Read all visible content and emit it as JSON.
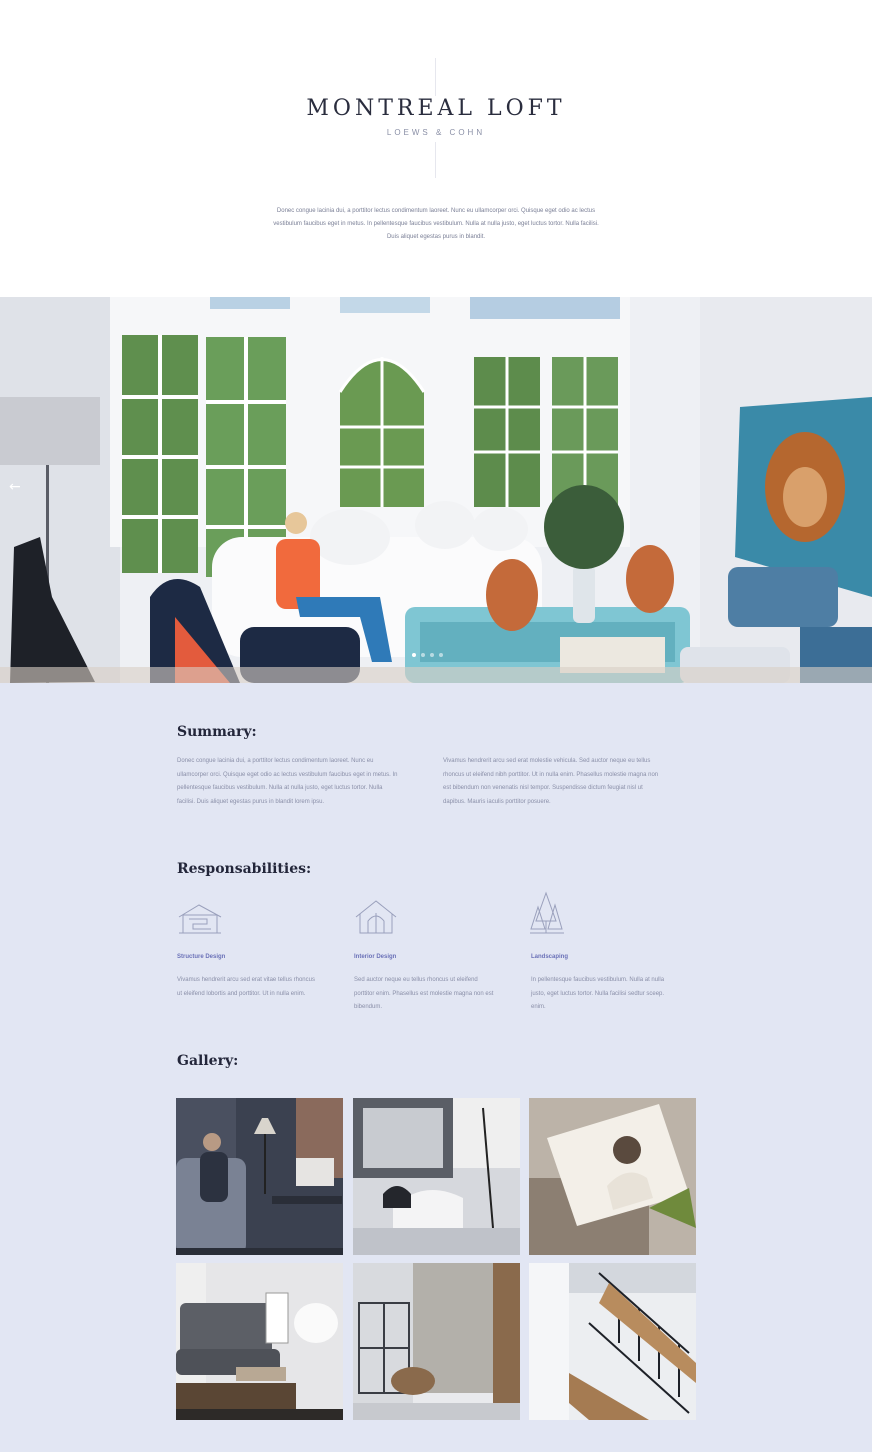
{
  "header": {
    "title": "MONTREAL LOFT",
    "subtitle": "LOEWS & COHN",
    "intro": "Donec congue lacinia dui, a porttitor lectus condimentum laoreet. Nunc eu ullamcorper orci. Quisque eget odio ac lectus vestibulum faucibus eget in metus. In pellentesque faucibus vestibulum. Nulla at nulla justo, eget luctus tortor. Nulla facilisi. Duis aliquet egestas purus in blandit."
  },
  "hero": {
    "prev_icon": "arrow-left-icon",
    "prev_glyph": "←",
    "slides": 4,
    "active_slide": 1
  },
  "summary": {
    "heading": "Summary:",
    "col1": "Donec congue lacinia dui, a porttitor lectus condimentum laoreet. Nunc eu ullamcorper orci. Quisque eget odio ac lectus vestibulum faucibus eget in metus. In pellentesque faucibus vestibulum. Nulla at nulla justo, eget luctus tortor. Nulla facilisi. Duis aliquet egestas purus in blandit lorem ipsu.",
    "col2": "Vivamus hendrerit arcu sed erat molestie vehicula. Sed auctor neque eu tellus rhoncus ut eleifend nibh porttitor. Ut in nulla enim. Phasellus molestie magna non est bibendum non venenatis nisl tempor. Suspendisse dictum feugiat nisl ut dapibus. Mauris iaculis porttitor posuere."
  },
  "responsabilities": {
    "heading": "Responsabilities:",
    "items": [
      {
        "icon": "structure-icon",
        "title": "Structure Design",
        "text": "Vivamus hendrerit arcu sed erat vitae tellus rhoncus ut eleifend lobortis and porttitor. Ut in nulla enim."
      },
      {
        "icon": "house-icon",
        "title": "Interior Design",
        "text": "Sed auctor neque eu tellus rhoncus ut eleifend porttitor enim. Phasellus est molestie magna non est bibendum."
      },
      {
        "icon": "trees-icon",
        "title": "Landscaping",
        "text": "In pellentesque faucibus vestibulum. Nulla at nulla justo, eget luctus tortor. Nulla facilisi sedtur sceep. enim."
      }
    ]
  },
  "gallery": {
    "heading": "Gallery:",
    "items": [
      {
        "name": "gallery-image-woman-armchair"
      },
      {
        "name": "gallery-image-white-chairs"
      },
      {
        "name": "gallery-image-magazine"
      },
      {
        "name": "gallery-image-grey-sofa"
      },
      {
        "name": "gallery-image-stone-wall"
      },
      {
        "name": "gallery-image-staircase"
      }
    ]
  },
  "colors": {
    "content_bg": "#e2e6f3",
    "accent": "#6b72b8",
    "heading": "#23263a"
  }
}
